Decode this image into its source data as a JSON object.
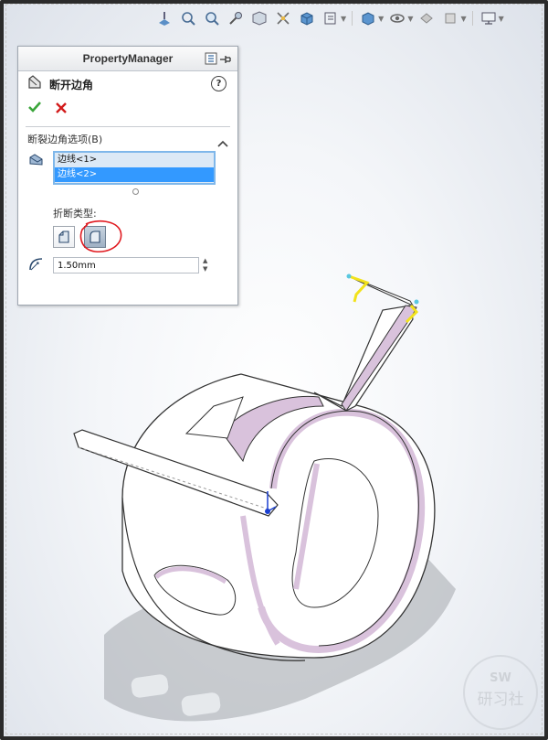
{
  "property_manager": {
    "title": "PropertyManager",
    "feature_title": "断开边角",
    "help_label": "?",
    "group_title": "断裂边角选项(B)",
    "edges": [
      "边线<1>",
      "边线<2>"
    ],
    "selected_edge_index": 1,
    "break_type_label": "折断类型:",
    "break_types": [
      "chamfer-break-type",
      "fillet-break-type"
    ],
    "active_break_type": "fillet-break-type",
    "radius_value": "1.50mm"
  },
  "heads_up_toolbar": {
    "icons": [
      "view-orientation-icon",
      "zoom-to-fit-icon",
      "zoom-to-area-icon",
      "previous-view-icon",
      "section-view-icon",
      "dynamic-annotation-icon",
      "view-orientation-cube-icon",
      "display-style-icon",
      "hide-show-items-icon",
      "edit-appearance-icon",
      "apply-scene-icon",
      "view-settings-icon"
    ]
  },
  "watermark": {
    "line1": "SW",
    "line2": "研习社"
  },
  "colors": {
    "accent_selection": "#3399ff",
    "listbox_bg": "#dce9f6",
    "sheetmetal_edge": "#d9c2dc",
    "highlight_red": "#e0191f",
    "check_green": "#3aa53a",
    "cross_red": "#d21b1b"
  }
}
